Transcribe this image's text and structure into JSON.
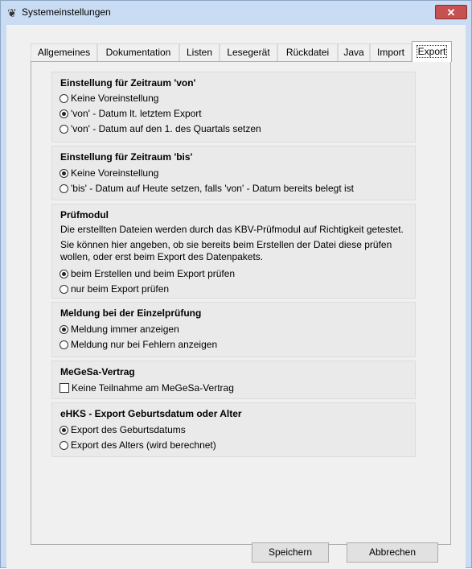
{
  "window": {
    "title": "Systemeinstellungen",
    "close_symbol": "✕"
  },
  "tabs": [
    {
      "label": "Allgemeines"
    },
    {
      "label": "Dokumentation"
    },
    {
      "label": "Listen"
    },
    {
      "label": "Lesegerät"
    },
    {
      "label": "Rückdatei"
    },
    {
      "label": "Java"
    },
    {
      "label": "Import"
    },
    {
      "label": "Export",
      "active": true
    }
  ],
  "groups": {
    "von": {
      "title": "Einstellung für Zeitraum 'von'",
      "options": [
        {
          "label": "Keine Voreinstellung",
          "checked": false
        },
        {
          "label": "'von' - Datum lt. letztem Export",
          "checked": true
        },
        {
          "label": "'von' - Datum auf den 1. des Quartals setzen",
          "checked": false
        }
      ]
    },
    "bis": {
      "title": "Einstellung für Zeitraum 'bis'",
      "options": [
        {
          "label": "Keine Voreinstellung",
          "checked": true
        },
        {
          "label": "'bis' - Datum auf Heute setzen, falls 'von' - Datum bereits belegt ist",
          "checked": false
        }
      ]
    },
    "pruefmodul": {
      "title": "Prüfmodul",
      "desc1": "Die erstellten Dateien werden durch das KBV-Prüfmodul auf Richtigkeit getestet.",
      "desc2a": "Sie können hier angeben, ob sie bereits beim Erstellen der Datei diese prüfen",
      "desc2b": "wollen, oder erst beim Export des Datenpakets.",
      "options": [
        {
          "label": "beim Erstellen und beim Export prüfen",
          "checked": true
        },
        {
          "label": "nur beim Export prüfen",
          "checked": false
        }
      ]
    },
    "meldung": {
      "title": "Meldung bei der Einzelprüfung",
      "options": [
        {
          "label": "Meldung immer anzeigen",
          "checked": true
        },
        {
          "label": "Meldung nur bei Fehlern anzeigen",
          "checked": false
        }
      ]
    },
    "megesa": {
      "title": "MeGeSa-Vertrag",
      "checkbox": {
        "label": "Keine Teilnahme am MeGeSa-Vertrag",
        "checked": false
      }
    },
    "ehks": {
      "title": "eHKS - Export Geburtsdatum oder Alter",
      "options": [
        {
          "label": "Export des Geburtsdatums",
          "checked": true
        },
        {
          "label": "Export des Alters (wird berechnet)",
          "checked": false
        }
      ]
    }
  },
  "buttons": {
    "save": "Speichern",
    "cancel": "Abbrechen"
  }
}
